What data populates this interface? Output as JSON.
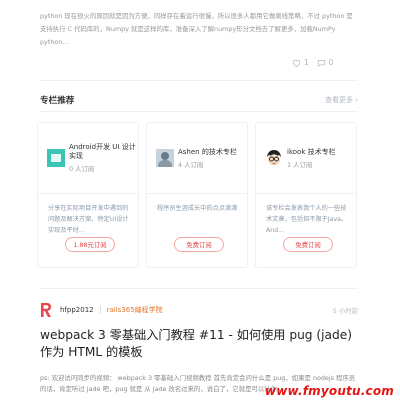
{
  "previous_post": {
    "excerpt": "python 现在很火的原因就是因为方便，同样存在着运行很慢，所以很多人都用它做离线策略，不过 python 是支持执行 C 代码库的，Numpy 就是这样的库，准备深入了解numpy形分文档去了解更多，加载NumPy python...",
    "likes": "1",
    "comments": "0"
  },
  "columns_section": {
    "title": "专栏推荐",
    "more_label": "查看更多 ›"
  },
  "cards": [
    {
      "title": "Android开发 UI 设计实现",
      "subscribers": "0 人订阅",
      "description": "分享在实际项目开发中遇到的问题及解决方案、特定UI设计实现及平时...",
      "button": "1.88元订阅",
      "cover_icon": "android-ui-cover"
    },
    {
      "title": "Ashen 的技术专栏",
      "subscribers": "4 人订阅",
      "description": "程序员生涯成长中的点点滴滴",
      "button": "免费订阅",
      "cover_icon": "ashen-avatar-cover"
    },
    {
      "title": "ikook 技术专栏",
      "subscribers": "1 人订阅",
      "description": "该专栏会发表我个人的一些技术文章，包括但不限于Java、And...",
      "button": "免费订阅",
      "cover_icon": "ikook-cartoon-cover"
    }
  ],
  "post": {
    "author": "hfpp2012",
    "tag": "rails365编程学院",
    "time": "5 小时前",
    "title": "webpack 3 零基础入门教程 #11 - 如何使用 pug (jade) 作为 HTML 的模板",
    "excerpt": "ps: 欢迎访问同步的视频： webpack 3 零基础入门视频教程 首先肯定会问什么是 pug，如果是 nodejs 程序员的话，肯定听过 jade 吧，pug 就是 从 jade 改名过来的，说白了，它就是可以让你..."
  },
  "watermark": "www.fmyoutu.com",
  "colors": {
    "accent_red": "#e5484d",
    "tag_orange": "#e0782c",
    "android_cover": "#3ec4b4",
    "watermark_red": "#e41414"
  }
}
